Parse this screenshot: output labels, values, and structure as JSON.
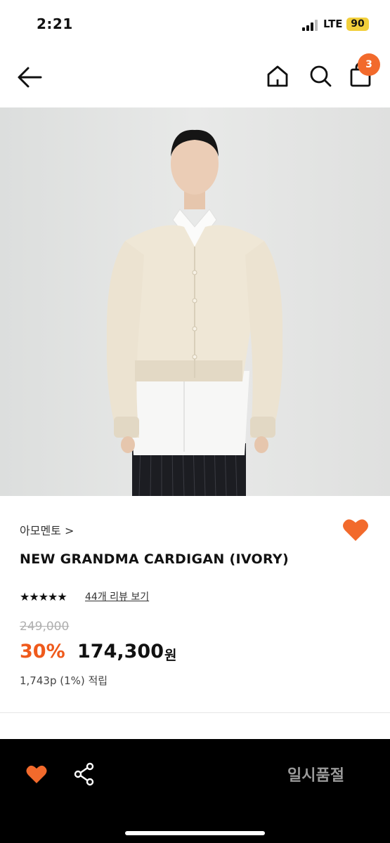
{
  "status_bar": {
    "time": "2:21",
    "network": "LTE",
    "battery": "90"
  },
  "nav": {
    "cart_count": "3"
  },
  "product": {
    "brand": "아모멘토 >",
    "title": "NEW GRANDMA CARDIGAN (IVORY)",
    "rating_stars": "★★★★★",
    "rating": 4.5,
    "review_link": "44개 리뷰 보기",
    "original_price": "249,000",
    "discount": "30%",
    "sale_price": "174,300",
    "currency": "원",
    "points": "1,743p (1%) 적립"
  },
  "bottom_bar": {
    "soldout_label": "일시품절"
  },
  "colors": {
    "accent": "#ef5a1c",
    "badge": "#f26a2c",
    "bottom_bar": "#000000"
  },
  "icons": [
    "back-arrow-icon",
    "home-icon",
    "search-icon",
    "shopping-bag-icon",
    "heart-icon",
    "share-icon",
    "signal-icon"
  ]
}
